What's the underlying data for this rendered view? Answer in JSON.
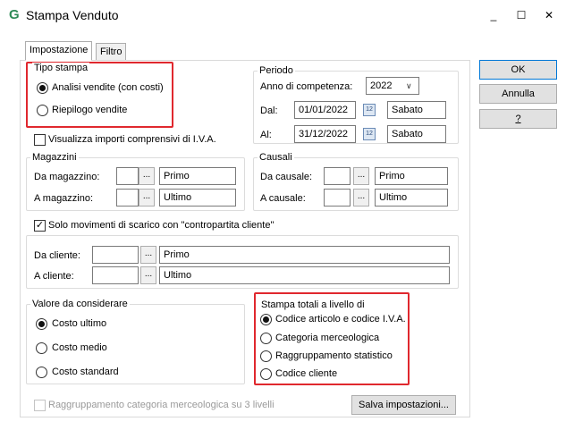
{
  "window": {
    "title": "Stampa Venduto",
    "minimize_glyph": "_",
    "maximize_glyph": "☐",
    "close_glyph": "✕"
  },
  "tabs": [
    "Impostazione",
    "Filtro"
  ],
  "tipo_stampa": {
    "legend": "Tipo stampa",
    "options": [
      "Analisi vendite (con costi)",
      "Riepilogo vendite"
    ],
    "selected": 0
  },
  "periodo": {
    "legend": "Periodo",
    "anno_label": "Anno di competenza:",
    "anno_value": "2022",
    "dal_label": "Dal:",
    "dal_value": "01/01/2022",
    "dal_day": "Sabato",
    "al_label": "Al:",
    "al_value": "31/12/2022",
    "al_day": "Sabato"
  },
  "iva_checkbox": {
    "label": "Visualizza importi comprensivi di I.V.A.",
    "checked": false
  },
  "magazzini": {
    "legend": "Magazzini",
    "da_label": "Da magazzino:",
    "da_desc": "Primo",
    "a_label": "A magazzino:",
    "a_desc": "Ultimo"
  },
  "causali": {
    "legend": "Causali",
    "da_label": "Da causale:",
    "da_desc": "Primo",
    "a_label": "A causale:",
    "a_desc": "Ultimo"
  },
  "scarico_checkbox": {
    "label": "Solo movimenti di scarico con \"contropartita cliente\"",
    "checked": true
  },
  "clienti": {
    "da_label": "Da cliente:",
    "da_desc": "Primo",
    "a_label": "A cliente:",
    "a_desc": "Ultimo"
  },
  "valore": {
    "legend": "Valore da considerare",
    "options": [
      "Costo ultimo",
      "Costo medio",
      "Costo standard"
    ],
    "selected": 0
  },
  "totali": {
    "legend": "Stampa totali a livello di",
    "options": [
      "Codice articolo e codice I.V.A.",
      "Categoria merceologica",
      "Raggruppamento statistico",
      "Codice cliente"
    ],
    "selected": 0
  },
  "raggruppamento_checkbox": {
    "label": "Raggruppamento categoria merceologica su 3 livelli",
    "checked": false
  },
  "buttons": {
    "ok": "OK",
    "annulla": "Annulla",
    "help": "?",
    "salva": "Salva impostazioni..."
  },
  "ellipsis": "...",
  "calendar_glyph": "12",
  "chevron_glyph": "∨",
  "checkmark_glyph": "✓",
  "colors": {
    "highlight": "#e0282e",
    "default_button_border": "#0078d7"
  }
}
